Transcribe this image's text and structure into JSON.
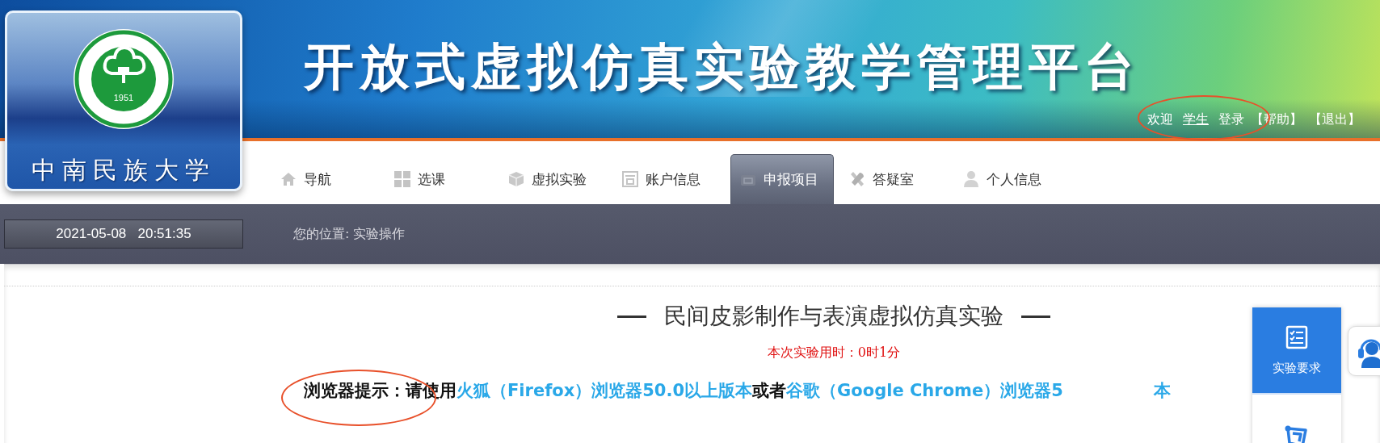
{
  "logo": {
    "seal_year": "1951",
    "name": "中南民族大学"
  },
  "title": "开放式虚拟仿真实验教学管理平台",
  "user_bar": {
    "circled": true,
    "items": [
      {
        "kind": "text",
        "label": "欢迎"
      },
      {
        "kind": "user",
        "label": "学生"
      },
      {
        "kind": "link",
        "label": "登录"
      },
      {
        "kind": "link",
        "label": "【帮助】"
      },
      {
        "kind": "link",
        "label": "【退出】"
      }
    ]
  },
  "nav": [
    {
      "label": "导航",
      "selected": false
    },
    {
      "label": "选课",
      "selected": false
    },
    {
      "label": "虚拟实验",
      "selected": false
    },
    {
      "label": "账户信息",
      "selected": false
    },
    {
      "label": "申报项目",
      "selected": true
    },
    {
      "label": "答疑室",
      "selected": false
    },
    {
      "label": "个人信息",
      "selected": false
    }
  ],
  "status_bar": {
    "datetime": "2021-05-08   20:51:35",
    "breadcrumb": "您的位置: 实验操作"
  },
  "experiment": {
    "title": "民间皮影制作与表演虚拟仿真实验",
    "timer": "本次实验用时：0时1分"
  },
  "notice": {
    "circled": true,
    "label": "浏览器提示：",
    "parts": [
      {
        "text": "请使用",
        "kind": "text"
      },
      {
        "text": "火狐（Firefox）浏览器50.0以上版本",
        "kind": "link"
      },
      {
        "text": "或者",
        "kind": "text"
      },
      {
        "text": "谷歌（Google Chrome）浏览器5",
        "kind": "link"
      }
    ],
    "tail": "本"
  },
  "side_panel": [
    {
      "kind": "requirements",
      "label": "实验要求",
      "selected": true
    },
    {
      "kind": "diagram",
      "selected": false
    }
  ]
}
